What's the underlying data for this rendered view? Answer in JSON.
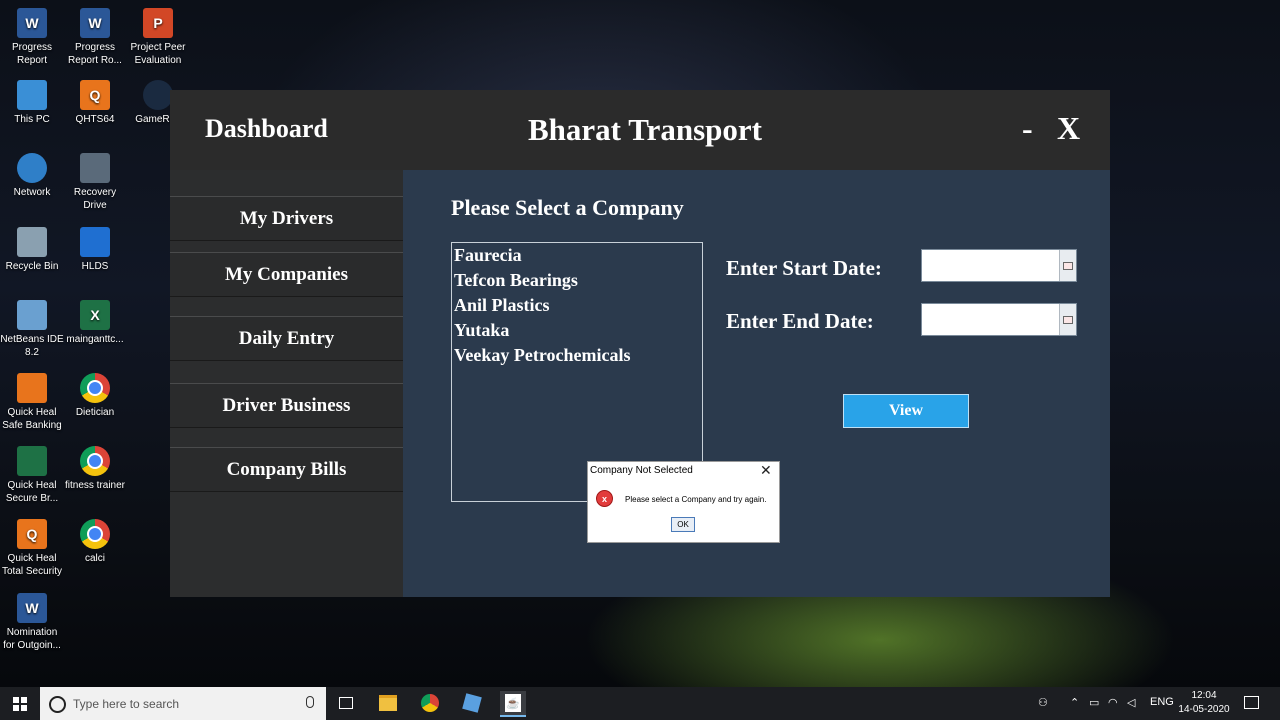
{
  "desktop": {
    "icons": [
      {
        "label": "Progress Report"
      },
      {
        "label": "Progress Report Ro..."
      },
      {
        "label": "Project Peer Evaluation"
      },
      {
        "label": "This PC"
      },
      {
        "label": "QHTS64"
      },
      {
        "label": "GameRan"
      },
      {
        "label": "Network"
      },
      {
        "label": "Recovery Drive"
      },
      {
        "label": "Recycle Bin"
      },
      {
        "label": "HLDS"
      },
      {
        "label": "NetBeans IDE 8.2"
      },
      {
        "label": "mainganttc..."
      },
      {
        "label": "Quick Heal Safe Banking"
      },
      {
        "label": "Dietician"
      },
      {
        "label": "Quick Heal Secure Br..."
      },
      {
        "label": "fitness trainer"
      },
      {
        "label": "Quick Heal Total Security"
      },
      {
        "label": "calci"
      },
      {
        "label": "Nomination for Outgoin..."
      }
    ],
    "icon_glyphs": {
      "word": "W",
      "ppt": "P",
      "excel": "X",
      "qh": "Q"
    }
  },
  "app": {
    "dashboard_title": "Dashboard",
    "app_title": "Bharat Transport",
    "minimize_label": "-",
    "close_label": "X",
    "sidebar": [
      {
        "label": "My Drivers"
      },
      {
        "label": "My Companies"
      },
      {
        "label": "Daily Entry"
      },
      {
        "label": "Driver Business"
      },
      {
        "label": "Company Bills"
      }
    ],
    "select_label": "Please Select a Company",
    "companies": [
      "Faurecia",
      "Tefcon Bearings",
      "Anil Plastics",
      "Yutaka",
      "Veekay Petrochemicals"
    ],
    "start_date_label": "Enter Start Date:",
    "end_date_label": "Enter End Date:",
    "start_date_value": "",
    "end_date_value": "",
    "view_button": "View",
    "colors": {
      "content_bg": "#2b3a4d",
      "sidebar_bg": "#2c2d2e",
      "view_button": "#29a3e8"
    }
  },
  "dialog": {
    "title": "Company Not Selected",
    "close_glyph": "✕",
    "error_glyph": "x",
    "message": "Please select a Company and try again.",
    "ok_label": "OK"
  },
  "taskbar": {
    "search_placeholder": "Type here to search",
    "language": "ENG",
    "time": "12:04",
    "date": "14-05-2020",
    "java_glyph": "☕"
  }
}
